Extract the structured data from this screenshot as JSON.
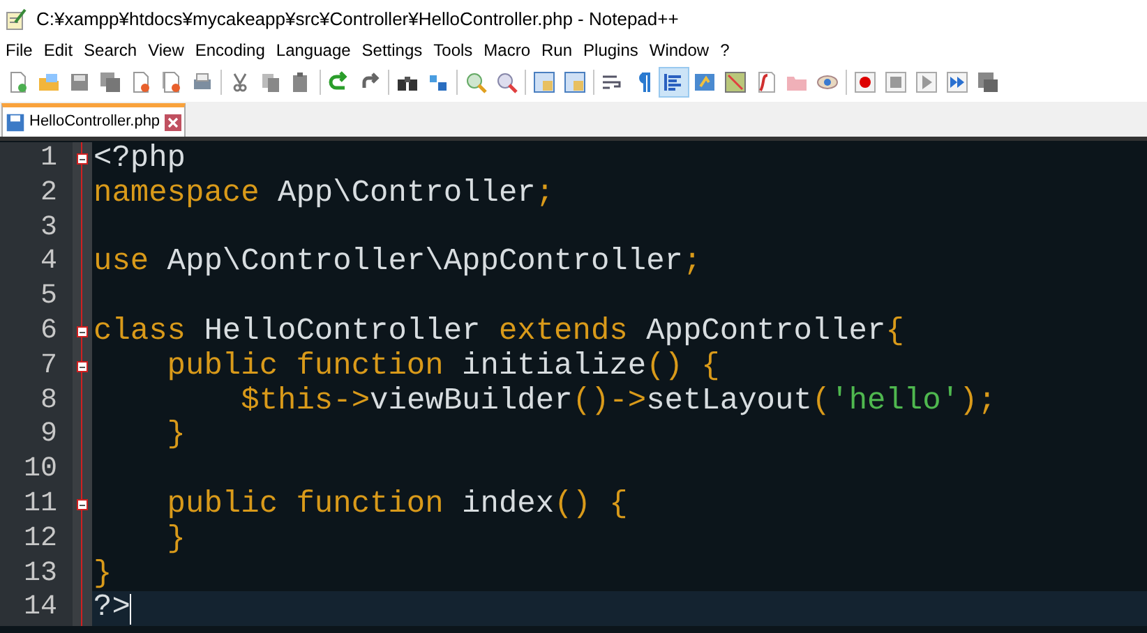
{
  "window": {
    "title": "C:¥xampp¥htdocs¥mycakeapp¥src¥Controller¥HelloController.php - Notepad++"
  },
  "menu": [
    "File",
    "Edit",
    "Search",
    "View",
    "Encoding",
    "Language",
    "Settings",
    "Tools",
    "Macro",
    "Run",
    "Plugins",
    "Window",
    "?"
  ],
  "toolbar": [
    {
      "pressed": false
    },
    {
      "pressed": false
    },
    {
      "pressed": false
    },
    {
      "pressed": false
    },
    {
      "pressed": false
    },
    {
      "pressed": false
    },
    {
      "pressed": false
    },
    {
      "pressed": false
    },
    {
      "pressed": false
    },
    {
      "pressed": false
    },
    {
      "pressed": false
    },
    {
      "pressed": false
    },
    {
      "pressed": false
    },
    {
      "pressed": false
    },
    {
      "pressed": false
    },
    {
      "pressed": false
    },
    {
      "pressed": false
    },
    {
      "pressed": false
    },
    {
      "pressed": false
    },
    {
      "pressed": false
    },
    {
      "pressed": true
    },
    {
      "pressed": false
    },
    {
      "pressed": false
    },
    {
      "pressed": false
    },
    {
      "pressed": false
    },
    {
      "pressed": false
    },
    {
      "pressed": false
    },
    {
      "pressed": false
    },
    {
      "pressed": false
    },
    {
      "pressed": false
    },
    {
      "pressed": false
    }
  ],
  "tabs": [
    {
      "label": "HelloController.php",
      "selected": true
    }
  ],
  "editor": {
    "lines": [
      {
        "number": "1",
        "fold": true,
        "current": false,
        "tokens": [
          {
            "text": "<?php",
            "kind": "plain"
          }
        ]
      },
      {
        "number": "2",
        "fold": false,
        "current": false,
        "tokens": [
          {
            "text": "namespace",
            "kind": "keyword"
          },
          {
            "text": " App\\Controller",
            "kind": "plain"
          },
          {
            "text": ";",
            "kind": "operator"
          }
        ]
      },
      {
        "number": "3",
        "fold": false,
        "current": false
      },
      {
        "number": "4",
        "fold": false,
        "current": false,
        "tokens": [
          {
            "text": "use",
            "kind": "keyword"
          },
          {
            "text": " App\\Controller\\AppController",
            "kind": "plain"
          },
          {
            "text": ";",
            "kind": "operator"
          }
        ]
      },
      {
        "number": "5",
        "fold": false,
        "current": false
      },
      {
        "number": "6",
        "fold": true,
        "current": false,
        "tokens": [
          {
            "text": "class",
            "kind": "keyword"
          },
          {
            "text": " HelloController ",
            "kind": "plain"
          },
          {
            "text": "extends",
            "kind": "keyword"
          },
          {
            "text": " AppController",
            "kind": "plain"
          },
          {
            "text": "{",
            "kind": "operator"
          }
        ]
      },
      {
        "number": "7",
        "fold": true,
        "current": false,
        "tokens": [
          {
            "text": "    public function",
            "kind": "keyword"
          },
          {
            "text": " initialize",
            "kind": "plain"
          },
          {
            "text": "() {",
            "kind": "operator"
          }
        ]
      },
      {
        "number": "8",
        "fold": false,
        "current": false,
        "tokens": [
          {
            "text": "        $this->",
            "kind": "keyword"
          },
          {
            "text": "viewBuilder",
            "kind": "plain"
          },
          {
            "text": "()->",
            "kind": "operator"
          },
          {
            "text": "setLayout",
            "kind": "plain"
          },
          {
            "text": "(",
            "kind": "operator"
          },
          {
            "text": "'hello'",
            "kind": "string"
          },
          {
            "text": ");",
            "kind": "operator"
          }
        ]
      },
      {
        "number": "9",
        "fold": false,
        "current": false,
        "tokens": [
          {
            "text": "    }",
            "kind": "operator"
          }
        ]
      },
      {
        "number": "10",
        "fold": false,
        "current": false
      },
      {
        "number": "11",
        "fold": true,
        "current": false,
        "tokens": [
          {
            "text": "    public function",
            "kind": "keyword"
          },
          {
            "text": " index",
            "kind": "plain"
          },
          {
            "text": "() {",
            "kind": "operator"
          }
        ]
      },
      {
        "number": "12",
        "fold": false,
        "current": false,
        "tokens": [
          {
            "text": "    }",
            "kind": "operator"
          }
        ]
      },
      {
        "number": "13",
        "fold": false,
        "current": false,
        "tokens": [
          {
            "text": "}",
            "kind": "operator"
          }
        ]
      },
      {
        "number": "14",
        "fold": false,
        "current": true,
        "tokens": [
          {
            "text": "?>",
            "kind": "plain"
          }
        ]
      }
    ]
  }
}
